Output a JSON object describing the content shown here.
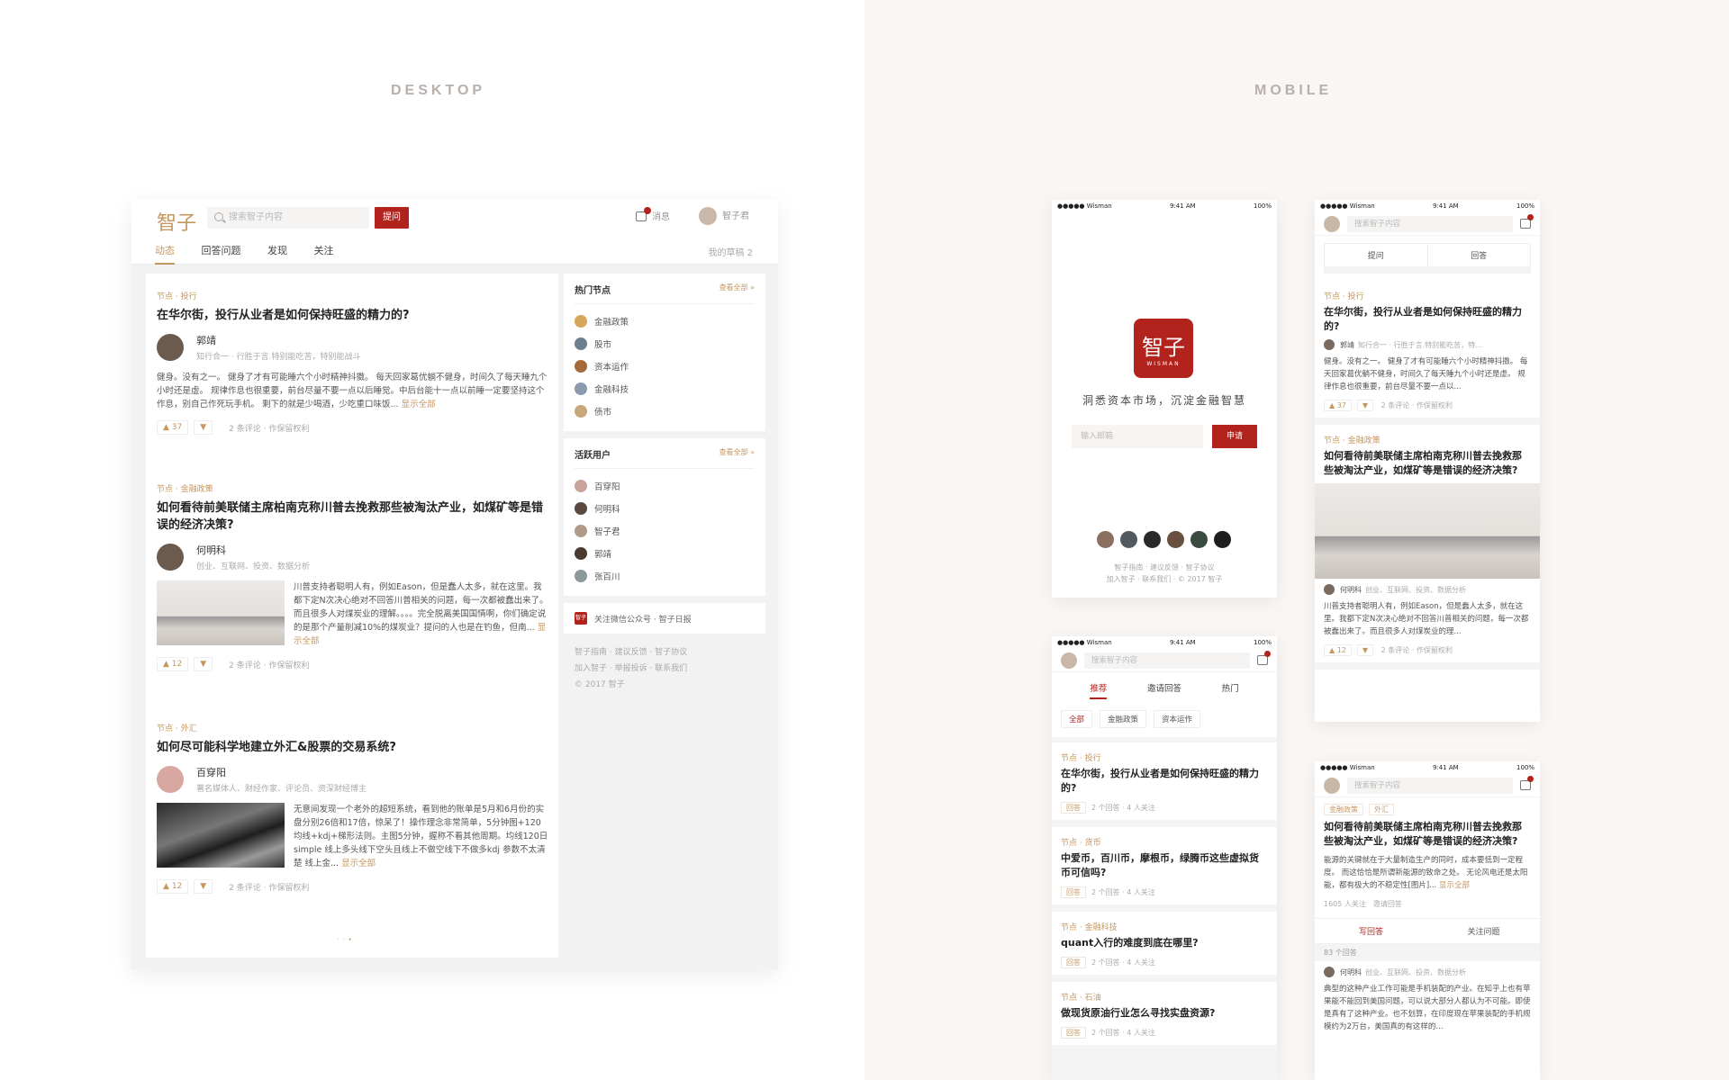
{
  "labels": {
    "desktop": "DESKTOP",
    "mobile": "MOBILE"
  },
  "desktop": {
    "logo": "智子",
    "search_placeholder": "搜索智子内容",
    "ask_button": "提问",
    "messages": "消息",
    "user_name": "智子君",
    "tabs": [
      "动态",
      "回答问题",
      "发现",
      "关注"
    ],
    "drafts": "我的草稿 2",
    "feed": [
      {
        "node": "节点 · 投行",
        "title": "在华尔街，投行从业者是如何保持旺盛的精力的?",
        "author": "郭靖",
        "bio": "知行合一 · 行胜于言.特别能吃苦，特别能战斗",
        "excerpt": "健身。没有之一。 健身了才有可能睡六个小时精神抖擞。 每天回家葛优躺不健身，时间久了每天睡九个小时还是虚。 规律作息也很重要，前台尽量不要一点以后睡觉。中后台能十一点以前睡一定要坚持这个作息，别自己作死玩手机。 剩下的就是少喝酒，少吃重口味饭...",
        "more": "显示全部",
        "votes": "37",
        "meta": "2 条评论 · 作保留权利"
      },
      {
        "node": "节点 · 金融政策",
        "title": "如何看待前美联储主席柏南克称川普去挽救那些被淘汰产业，如煤矿等是错误的经济决策?",
        "author": "何明科",
        "bio": "创业、互联网、投资、数据分析",
        "excerpt": "川普支持者聪明人有，例如Eason，但是蠢人太多，就在这里。我都下定N次决心绝对不回答川普相关的问题，每一次都被蠢出来了。而且很多人对煤炭业的理解。。。。完全脱离美国国情啊，你们确定说的是那个产量削减10%的煤炭业？提问的人也是在钓鱼，但南...",
        "more": "显示全部",
        "votes": "12",
        "meta": "2 条评论 · 作保留权利"
      },
      {
        "node": "节点 · 外汇",
        "title": "如何尽可能科学地建立外汇&股票的交易系统?",
        "author": "百穿阳",
        "bio": "著名媒体人、财经作家、评论员、资深财经博主",
        "excerpt": "无意间发现一个老外的超短系统，看到他的账单是5月和6月份的实盘分别26倍和17倍，惊呆了！操作理念非常简单，5分钟图+120均线+kdj+梯形法则。主图5分钟，握称不看其他周期。均线120日simple 线上多头线下空头且线上不做空线下不做多kdj 参数不太清楚 线上金...",
        "more": "显示全部",
        "votes": "12",
        "meta": "2 条评论 · 作保留权利"
      }
    ],
    "pager": "·",
    "hot_nodes": {
      "title": "热门节点",
      "all": "查看全部 »",
      "items": [
        "金融政策",
        "股市",
        "资本运作",
        "金融科技",
        "债市"
      ]
    },
    "active_users": {
      "title": "活跃用户",
      "all": "查看全部 »",
      "items": [
        "百穿阳",
        "何明科",
        "智子君",
        "郭靖",
        "张百川"
      ]
    },
    "follow_wechat": "关注微信公众号 · 智子日报",
    "badge": "智子",
    "footer": [
      "智子指南 · 建议反馈 · 智子协议",
      "加入智子 · 举报投诉 · 联系我们",
      "© 2017 智子"
    ]
  },
  "mobile": {
    "status": {
      "carrier": "●●●●● Wisman",
      "time": "9:41 AM",
      "battery": "100%"
    },
    "splash": {
      "logo": "智子",
      "logo_sub": "WISMAN",
      "slogan": "洞悉资本市场，沉淀金融智慧",
      "email_placeholder": "输入邮箱",
      "apply": "申请",
      "footer1": "智子指南 · 建议反馈 · 智子协议",
      "footer2": "加入智子 · 联系我们 · © 2017 智子"
    },
    "search_placeholder": "搜索智子内容",
    "answer_tabs": [
      "推荐",
      "邀请回答",
      "热门"
    ],
    "chips": [
      "全部",
      "金融政策",
      "资本运作"
    ],
    "questions": [
      {
        "node": "节点 · 投行",
        "title": "在华尔街，投行从业者是如何保持旺盛的精力的?",
        "btn": "回答",
        "meta": "2 个回答 · 4 人关注"
      },
      {
        "node": "节点 · 货币",
        "title": "中爱币，百川币，摩根币，绿腾币这些虚拟货币可信吗?",
        "btn": "回答",
        "meta": "2 个回答 · 4 人关注"
      },
      {
        "node": "节点 · 金融科技",
        "title": "quant入行的难度到底在哪里?",
        "btn": "回答",
        "meta": "2 个回答 · 4 人关注"
      },
      {
        "node": "节点 · 石油",
        "title": "做现货原油行业怎么寻找实盘资源?",
        "btn": "回答",
        "meta": "2 个回答 · 4 人关注"
      }
    ],
    "feed_actions": [
      "提问",
      "回答"
    ],
    "feed": [
      {
        "node": "节点 · 投行",
        "title": "在华尔街，投行从业者是如何保持旺盛的精力的?",
        "author": "郭靖",
        "bio": "知行合一 · 行胜于言.特别能吃苦，特...",
        "excerpt": "健身。没有之一。 健身了才有可能睡六个小时精神抖擞。 每天回家葛优躺不健身，时间久了每天睡九个小时还是虚。 规律作息也很重要，前台尽量不要一点以...",
        "votes": "37",
        "meta": "2 条评论 · 作保留权利"
      },
      {
        "node": "节点 · 金融政策",
        "title": "如何看待前美联储主席柏南克称川普去挽救那些被淘汰产业，如煤矿等是错误的经济决策?",
        "author": "何明科",
        "bio": "创业、互联网、投资、数据分析",
        "excerpt": "川普支持者聪明人有，例如Eason，但是蠢人太多，就在这里。我都下定N次决心绝对不回答川普相关的问题，每一次都被蠢出来了。而且很多人对煤炭业的理...",
        "votes": "12",
        "meta": "2 条评论 · 作保留权利"
      }
    ],
    "detail": {
      "tags": [
        "金融政策",
        "外汇"
      ],
      "title": "如何看待前美联储主席柏南克称川普去挽救那些被淘汰产业，如煤矿等是错误的经济决策?",
      "excerpt": "能源的关键就在于大量制造生产的同时，成本要低到一定程度。 而这恰恰是所谓新能源的致命之处。 无论风电还是太阳能，都有极大的不稳定性[图片]...",
      "more": "显示全部",
      "followers": "1605 人关注",
      "invite": "邀请回答",
      "write": "写回答",
      "follow": "关注问题",
      "answers": "83 个回答",
      "author": "何明科",
      "bio": "创业、互联网、投资、数据分析",
      "answer_excerpt": "典型的这种产业工作可能是手机装配的产业。在知乎上也有苹果能不能回到美国问题，可以说大部分人都认为不可能。即使是真有了这种产业。也不划算，在印度现在苹果装配的手机规模约为2万台，美国真的有这样的..."
    }
  }
}
